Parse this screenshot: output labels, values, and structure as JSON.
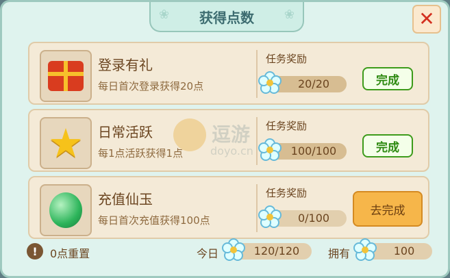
{
  "window": {
    "title": "获得点数",
    "close_icon": "close-icon"
  },
  "tasks": [
    {
      "title": "登录有礼",
      "desc": "每日首次登录获得20点",
      "reward_label": "任务奖励",
      "progress": "20/20",
      "progress_ratio": 1,
      "button": "完成",
      "icon": "gift-icon"
    },
    {
      "title": "日常活跃",
      "desc": "每1点活跃获得1点",
      "reward_label": "任务奖励",
      "progress": "100/100",
      "progress_ratio": 1,
      "button": "完成",
      "icon": "star-icon"
    },
    {
      "title": "充值仙玉",
      "desc": "每日首次充值获得100点",
      "reward_label": "任务奖励",
      "progress": "0/100",
      "progress_ratio": 0,
      "button": "去完成",
      "icon": "jade-icon"
    }
  ],
  "footer": {
    "reset_text": "0点重置",
    "today_label": "今日",
    "today_value": "120/120",
    "own_label": "拥有",
    "own_value": "100"
  },
  "watermark": {
    "cn": "逗游",
    "en": "doyo.cn"
  },
  "colors": {
    "accent": "#3d9b1b",
    "panel": "#dff3ee",
    "card": "#f4ead7"
  }
}
